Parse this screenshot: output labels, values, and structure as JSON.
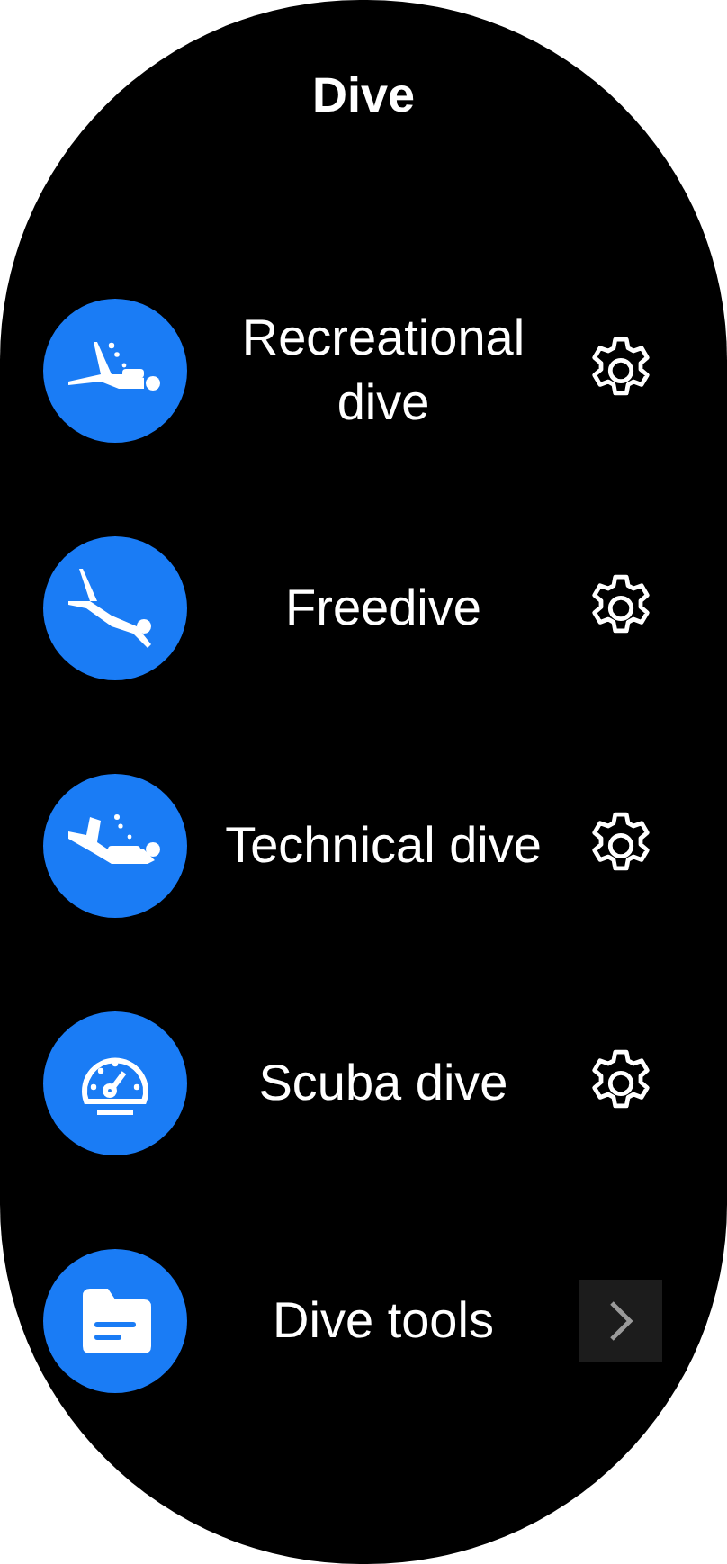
{
  "title": "Dive",
  "items": [
    {
      "label": "Recreational dive",
      "kind": "settings"
    },
    {
      "label": "Freedive",
      "kind": "settings"
    },
    {
      "label": "Technical dive",
      "kind": "settings"
    },
    {
      "label": "Scuba dive",
      "kind": "settings"
    },
    {
      "label": "Dive tools",
      "kind": "link"
    }
  ]
}
